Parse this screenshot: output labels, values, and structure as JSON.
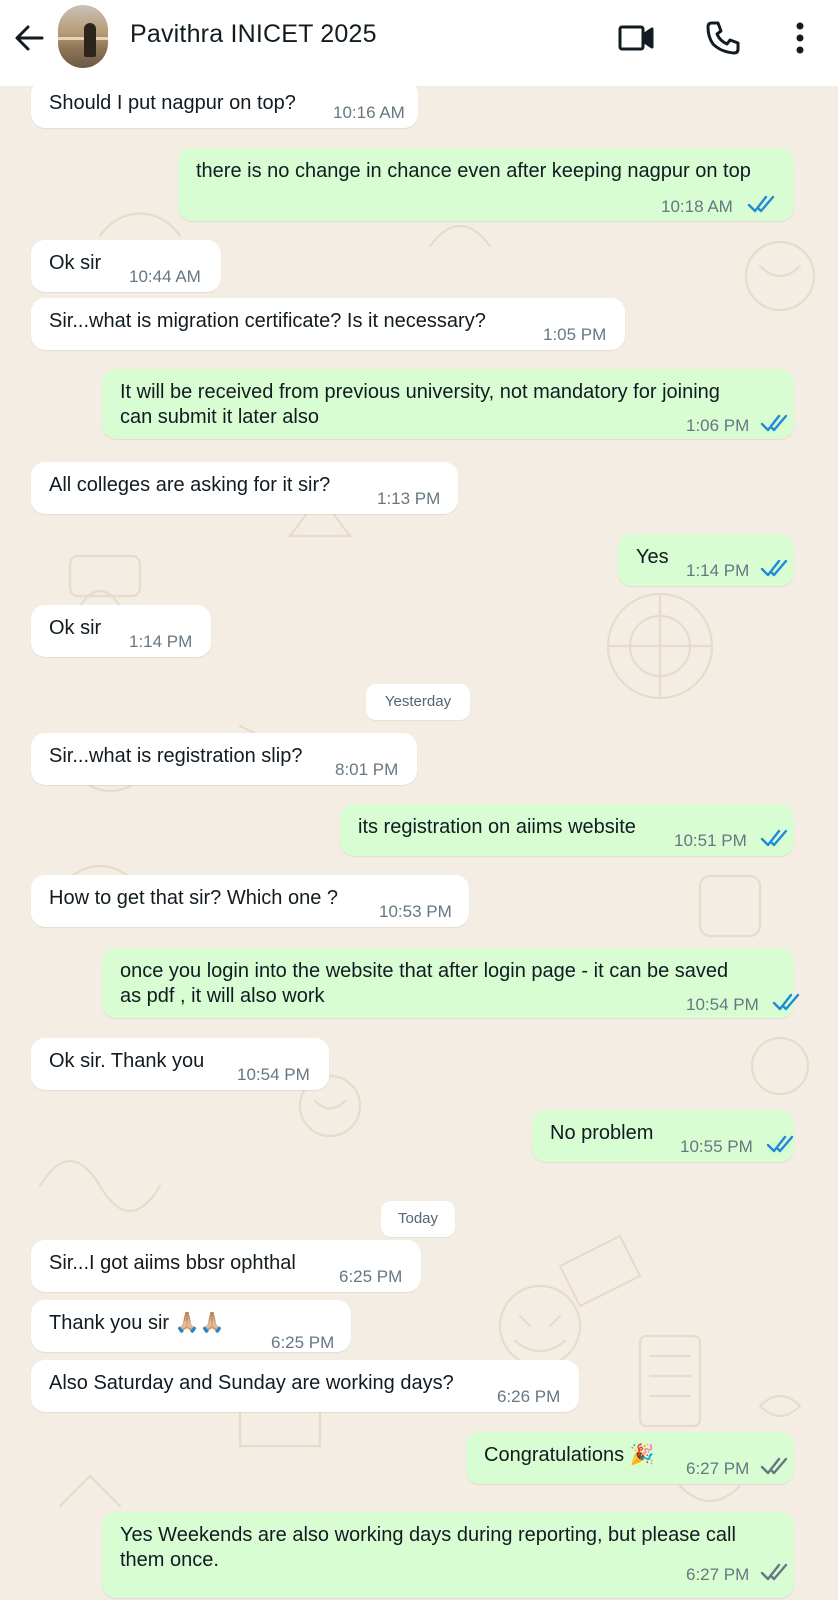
{
  "header": {
    "contact_name": "Pavithra INICET 2025",
    "icons": [
      "back-arrow-icon",
      "video-call-icon",
      "phone-call-icon",
      "more-options-icon"
    ]
  },
  "colors": {
    "incoming_bubble": "#ffffff",
    "outgoing_bubble": "#d9fdd3",
    "read_tick_blue": "#1d8bd8",
    "sent_tick_grey": "#667781",
    "chat_background": "#f4ede3"
  },
  "messages": [
    {
      "dir": "in",
      "text": "Should I put nagpur on top?",
      "time": "10:16 AM"
    },
    {
      "dir": "out",
      "text": "there is no change in chance even after keeping nagpur on top",
      "time": "10:18 AM",
      "ticks": "read"
    },
    {
      "dir": "in",
      "text": "Ok sir",
      "time": "10:44 AM"
    },
    {
      "dir": "in",
      "text": "Sir...what is migration certificate? Is it necessary?",
      "time": "1:05 PM"
    },
    {
      "dir": "out",
      "text": "It will be received from previous university, not mandatory for joining\ncan submit it later also",
      "time": "1:06 PM",
      "ticks": "read"
    },
    {
      "dir": "in",
      "text": "All colleges are asking for it sir?",
      "time": "1:13 PM"
    },
    {
      "dir": "out",
      "text": "Yes",
      "time": "1:14 PM",
      "ticks": "read"
    },
    {
      "dir": "in",
      "text": "Ok sir",
      "time": "1:14 PM"
    },
    {
      "dir": "in",
      "text": "Sir...what is registration slip?",
      "time": "8:01 PM"
    },
    {
      "dir": "out",
      "text": "its registration on aiims website",
      "time": "10:51 PM",
      "ticks": "read"
    },
    {
      "dir": "in",
      "text": "How to get that sir? Which one ?",
      "time": "10:53 PM"
    },
    {
      "dir": "out",
      "text": "once you login into the website that after login page - it can be saved\nas pdf , it will also work",
      "time": "10:54 PM",
      "ticks": "read"
    },
    {
      "dir": "in",
      "text": "Ok sir. Thank you",
      "time": "10:54 PM"
    },
    {
      "dir": "out",
      "text": "No problem",
      "time": "10:55 PM",
      "ticks": "read"
    },
    {
      "dir": "in",
      "text": "Sir...I got aiims bbsr ophthal",
      "time": "6:25 PM"
    },
    {
      "dir": "in",
      "text": "Thank you sir",
      "emoji": "🙏🏼🙏🏼",
      "time": "6:25 PM"
    },
    {
      "dir": "in",
      "text": "Also Saturday and Sunday are working days?",
      "time": "6:26 PM"
    },
    {
      "dir": "out",
      "text": "Congratulations",
      "emoji": "🎉",
      "time": "6:27 PM",
      "ticks": "delivered"
    },
    {
      "dir": "out",
      "text": "Yes Weekends are also working days during reporting, but please call\nthem once.",
      "time": "6:27 PM",
      "ticks": "delivered"
    }
  ],
  "day_separators": [
    "Yesterday",
    "Today"
  ]
}
